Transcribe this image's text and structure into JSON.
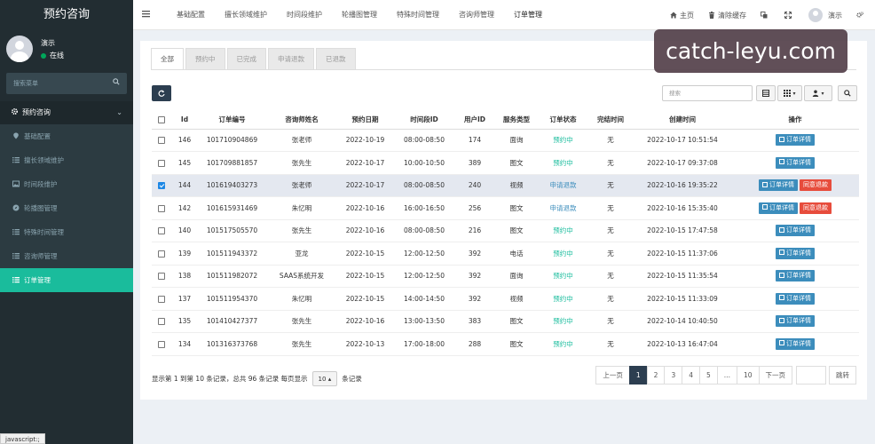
{
  "sidebar": {
    "title": "预约咨询",
    "user_name": "演示",
    "user_status": "在线",
    "search_placeholder": "搜索菜单",
    "group_label": "预约咨询",
    "items": [
      {
        "label": "基础配置",
        "icon": "map-marker-icon"
      },
      {
        "label": "擅长领域维护",
        "icon": "list-icon"
      },
      {
        "label": "时间段维护",
        "icon": "image-icon"
      },
      {
        "label": "轮播图管理",
        "icon": "compass-icon"
      },
      {
        "label": "特殊时间管理",
        "icon": "list-icon"
      },
      {
        "label": "咨询师管理",
        "icon": "list-icon"
      },
      {
        "label": "订单管理",
        "icon": "list-icon",
        "active": true
      }
    ]
  },
  "navbar": {
    "links": [
      "基础配置",
      "擅长领域维护",
      "时间段维护",
      "轮播图管理",
      "特殊时间管理",
      "咨询师管理",
      "订单管理"
    ],
    "home": "主页",
    "clear_cache": "清除缓存",
    "user": "演示"
  },
  "tabs": [
    "全部",
    "预约中",
    "已完成",
    "申请退款",
    "已退款"
  ],
  "search_placeholder": "搜索",
  "table": {
    "headers": [
      "Id",
      "订单编号",
      "咨询师姓名",
      "预约日期",
      "时间段ID",
      "用户ID",
      "服务类型",
      "订单状态",
      "完结时间",
      "创建时间",
      "操作"
    ],
    "rows": [
      {
        "id": "146",
        "order_no": "101710904869",
        "counselor": "张老师",
        "date": "2022-10-19",
        "slot": "08:00-08:50",
        "user_id": "174",
        "service": "面询",
        "status": "预约中",
        "finish": "无",
        "created": "2022-10-17 10:51:54",
        "checked": false,
        "refund": false
      },
      {
        "id": "145",
        "order_no": "101709881857",
        "counselor": "张先生",
        "date": "2022-10-17",
        "slot": "10:00-10:50",
        "user_id": "389",
        "service": "图文",
        "status": "预约中",
        "finish": "无",
        "created": "2022-10-17 09:37:08",
        "checked": false,
        "refund": false
      },
      {
        "id": "144",
        "order_no": "101619403273",
        "counselor": "张老师",
        "date": "2022-10-17",
        "slot": "08:00-08:50",
        "user_id": "240",
        "service": "视频",
        "status": "申请退款",
        "finish": "无",
        "created": "2022-10-16 19:35:22",
        "checked": true,
        "refund": true
      },
      {
        "id": "142",
        "order_no": "101615931469",
        "counselor": "朱忆明",
        "date": "2022-10-16",
        "slot": "16:00-16:50",
        "user_id": "256",
        "service": "图文",
        "status": "申请退款",
        "finish": "无",
        "created": "2022-10-16 15:35:40",
        "checked": false,
        "refund": true
      },
      {
        "id": "140",
        "order_no": "101517505570",
        "counselor": "张先生",
        "date": "2022-10-16",
        "slot": "08:00-08:50",
        "user_id": "216",
        "service": "图文",
        "status": "预约中",
        "finish": "无",
        "created": "2022-10-15 17:47:58",
        "checked": false,
        "refund": false
      },
      {
        "id": "139",
        "order_no": "101511943372",
        "counselor": "亚龙",
        "date": "2022-10-15",
        "slot": "12:00-12:50",
        "user_id": "392",
        "service": "电话",
        "status": "预约中",
        "finish": "无",
        "created": "2022-10-15 11:37:06",
        "checked": false,
        "refund": false
      },
      {
        "id": "138",
        "order_no": "101511982072",
        "counselor": "SAAS系统开发",
        "date": "2022-10-15",
        "slot": "12:00-12:50",
        "user_id": "392",
        "service": "面询",
        "status": "预约中",
        "finish": "无",
        "created": "2022-10-15 11:35:54",
        "checked": false,
        "refund": false
      },
      {
        "id": "137",
        "order_no": "101511954370",
        "counselor": "朱忆明",
        "date": "2022-10-15",
        "slot": "14:00-14:50",
        "user_id": "392",
        "service": "视频",
        "status": "预约中",
        "finish": "无",
        "created": "2022-10-15 11:33:09",
        "checked": false,
        "refund": false
      },
      {
        "id": "135",
        "order_no": "101410427377",
        "counselor": "张先生",
        "date": "2022-10-16",
        "slot": "13:00-13:50",
        "user_id": "383",
        "service": "图文",
        "status": "预约中",
        "finish": "无",
        "created": "2022-10-14 10:40:50",
        "checked": false,
        "refund": false
      },
      {
        "id": "134",
        "order_no": "101316373768",
        "counselor": "张先生",
        "date": "2022-10-13",
        "slot": "17:00-18:00",
        "user_id": "288",
        "service": "图文",
        "status": "预约中",
        "finish": "无",
        "created": "2022-10-13 16:47:04",
        "checked": false,
        "refund": false
      }
    ],
    "detail_label": "订单详情",
    "refund_label": "同意退款"
  },
  "footer": {
    "info_before": "显示第 1 到第 10 条记录，总共 96 条记录 每页显示",
    "page_size": "10",
    "info_after": "条记录"
  },
  "pager": {
    "prev": "上一页",
    "pages": [
      "1",
      "2",
      "3",
      "4",
      "5",
      "...",
      "10"
    ],
    "next": "下一页",
    "jump": "跳转"
  },
  "watermark": "catch-leyu.com",
  "status_bar": "javascript:;",
  "colors": {
    "sidebar_bg": "#222d32",
    "active_item": "#1abc9c",
    "status_green": "#18bc9c",
    "status_blue": "#3c8dbc",
    "detail_btn": "#3c8dbc",
    "refund_btn": "#e74c3c"
  }
}
